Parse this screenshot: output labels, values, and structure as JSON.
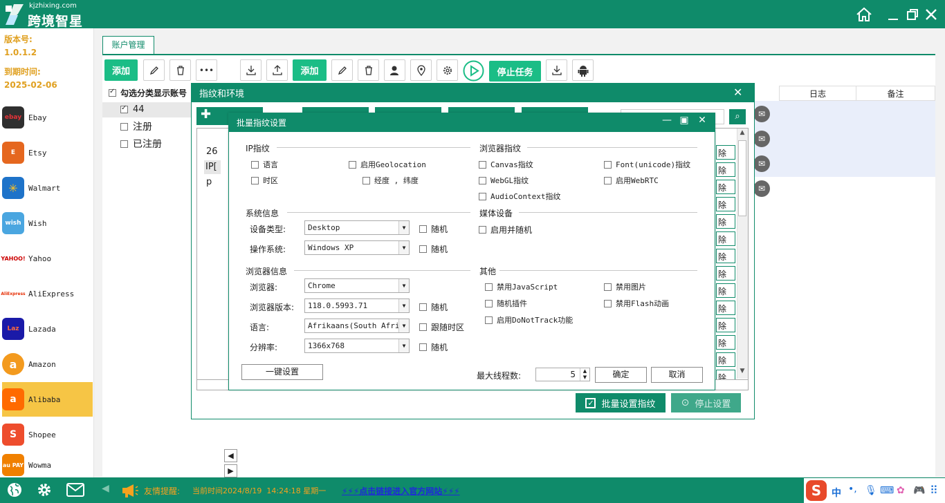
{
  "app": {
    "domain": "kjzhixing.com",
    "name": "跨境智星"
  },
  "sidebar": {
    "version_label": "版本号:",
    "version": "1.0.1.2",
    "expire_label": "到期时间:",
    "expire_date": "2025-02-06",
    "platforms": [
      {
        "name": "Ebay",
        "color": "#2f2f2f"
      },
      {
        "name": "Etsy",
        "color": "#e5671f"
      },
      {
        "name": "Walmart",
        "color": "#1e73c9"
      },
      {
        "name": "Wish",
        "color": "#4aa6e0"
      },
      {
        "name": "Yahoo",
        "color": "#ffffff"
      },
      {
        "name": "AliExpress",
        "color": "#ffffff"
      },
      {
        "name": "Lazada",
        "color": "#1a1aa8"
      },
      {
        "name": "Amazon",
        "color": "#f39a1e"
      },
      {
        "name": "Alibaba",
        "color": "#f6c545"
      },
      {
        "name": "Shopee",
        "color": "#ee4d2d"
      },
      {
        "name": "Wowma",
        "color": "#f08000"
      }
    ],
    "active_index": 8
  },
  "main": {
    "tab_label": "账户管理",
    "add_label": "添加",
    "add2_label": "添加",
    "stop_task_label": "停止任务",
    "select_all_label": "勾选分类显示账号",
    "categories": [
      {
        "label": "44",
        "checked": true
      },
      {
        "label": "注册",
        "checked": false
      },
      {
        "label": "已注册",
        "checked": false
      }
    ],
    "columns": {
      "log": "日志",
      "note": "备注"
    },
    "partial_rows": [
      "26",
      "IP[",
      "p"
    ],
    "delete_fragment": "除"
  },
  "dialog_env": {
    "title": "指纹和环境",
    "batch_set_label": "批量设置指纹",
    "stop_set_label": "停止设置"
  },
  "dialog_batch": {
    "title": "批量指纹设置",
    "ip_section": "IP指纹",
    "ip_opts": {
      "lang": "语言",
      "tz": "时区",
      "geo": "启用Geolocation",
      "lnglat": "经度 , 纬度"
    },
    "browser_fp_section": "浏览器指纹",
    "browser_fp_opts": {
      "canvas": "Canvas指纹",
      "font": "Font(unicode)指纹",
      "webgl": "WebGL指纹",
      "webrtc": "启用WebRTC",
      "audio": "AudioContext指纹"
    },
    "sys_section": "系统信息",
    "device_type_label": "设备类型:",
    "device_type_value": "Desktop",
    "os_label": "操作系统:",
    "os_value": "Windows XP",
    "random_label": "随机",
    "media_section": "媒体设备",
    "media_opt": "启用并随机",
    "browser_info_section": "浏览器信息",
    "browser_label": "浏览器:",
    "browser_value": "Chrome",
    "browser_ver_label": "浏览器版本:",
    "browser_ver_value": "118.0.5993.71",
    "lang_label": "语言:",
    "lang_value": "Afrikaans(South Afri",
    "follow_tz_label": "跟随时区",
    "res_label": "分辨率:",
    "res_value": "1366x768",
    "other_section": "其他",
    "other_opts": {
      "js": "禁用JavaScript",
      "img": "禁用图片",
      "plugin": "随机插件",
      "flash": "禁用Flash动画",
      "dnt": "启用DoNotTrack功能"
    },
    "one_key_label": "一键设置",
    "max_threads_label": "最大线程数:",
    "max_threads_value": "5",
    "ok_label": "确定",
    "cancel_label": "取消"
  },
  "footer": {
    "tip_label": "友情提醒:",
    "time_text": "当前时间2024/8/19  14:24:18 星期一",
    "link_text": "⚡⚡⚡点击链接进入官方网站⚡⚡⚡",
    "ime_lang": "中"
  }
}
